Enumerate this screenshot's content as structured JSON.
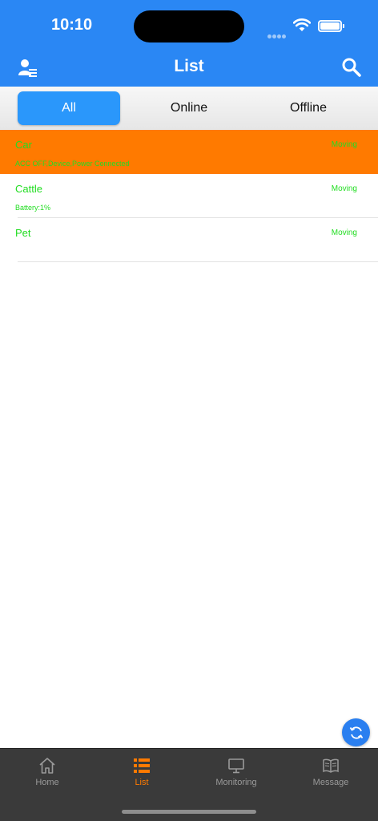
{
  "status_bar": {
    "time": "10:10"
  },
  "nav": {
    "title": "List"
  },
  "segments": {
    "all": "All",
    "online": "Online",
    "offline": "Offline"
  },
  "list": {
    "items": [
      {
        "name": "Car",
        "status": "Moving",
        "detail": "ACC OFF,Device,Power Connected",
        "highlight": true
      },
      {
        "name": "Cattle",
        "status": "Moving",
        "detail": "Battery:1%"
      },
      {
        "name": "Pet",
        "status": "Moving",
        "detail": ""
      }
    ]
  },
  "tab_bar": {
    "home": "Home",
    "list": "List",
    "monitoring": "Monitoring",
    "message": "Message"
  },
  "colors": {
    "header": "#2a87f4",
    "segment_active": "#2a97fb",
    "highlight_row": "#ff7a00",
    "status_text": "#22dd22",
    "tab_active": "#ff7a00"
  }
}
